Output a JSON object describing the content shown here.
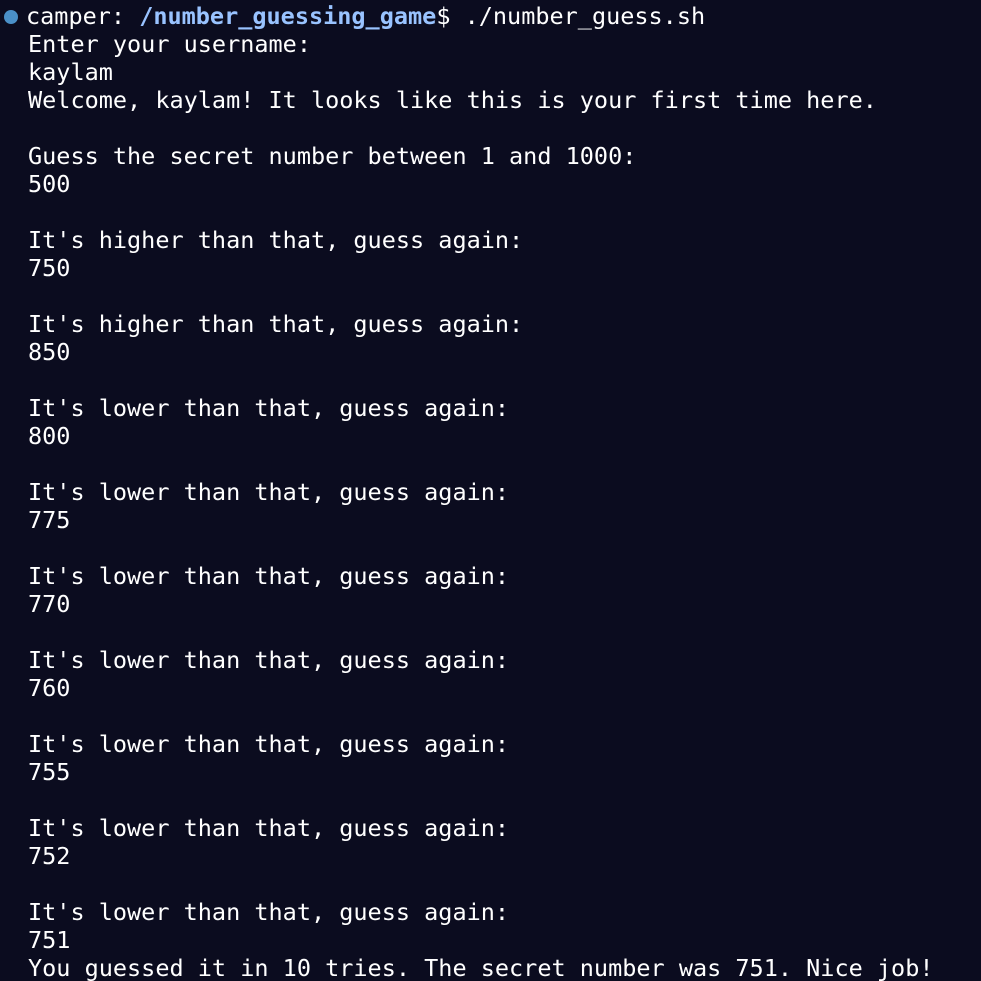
{
  "colors": {
    "background": "#0b0c1f",
    "text": "#ffffff",
    "path": "#99c3ff",
    "status_dot": "#4a90c8"
  },
  "prompt": {
    "status_icon": "circle-dot-icon",
    "user": "camper: ",
    "path": "/number_guessing_game",
    "symbol_and_command": "$ ./number_guess.sh"
  },
  "output": {
    "username_prompt": "Enter your username:",
    "username_input": "kaylam",
    "welcome": "Welcome, kaylam! It looks like this is your first time here.",
    "guess_prompt": "Guess the secret number between 1 and 1000:",
    "guess_1": "500",
    "hint_1": "It's higher than that, guess again:",
    "guess_2": "750",
    "hint_2": "It's higher than that, guess again:",
    "guess_3": "850",
    "hint_3": "It's lower than that, guess again:",
    "guess_4": "800",
    "hint_4": "It's lower than that, guess again:",
    "guess_5": "775",
    "hint_5": "It's lower than that, guess again:",
    "guess_6": "770",
    "hint_6": "It's lower than that, guess again:",
    "guess_7": "760",
    "hint_7": "It's lower than that, guess again:",
    "guess_8": "755",
    "hint_8": "It's lower than that, guess again:",
    "guess_9": "752",
    "hint_9": "It's lower than that, guess again:",
    "guess_10": "751",
    "result": "You guessed it in 10 tries. The secret number was 751. Nice job!"
  }
}
